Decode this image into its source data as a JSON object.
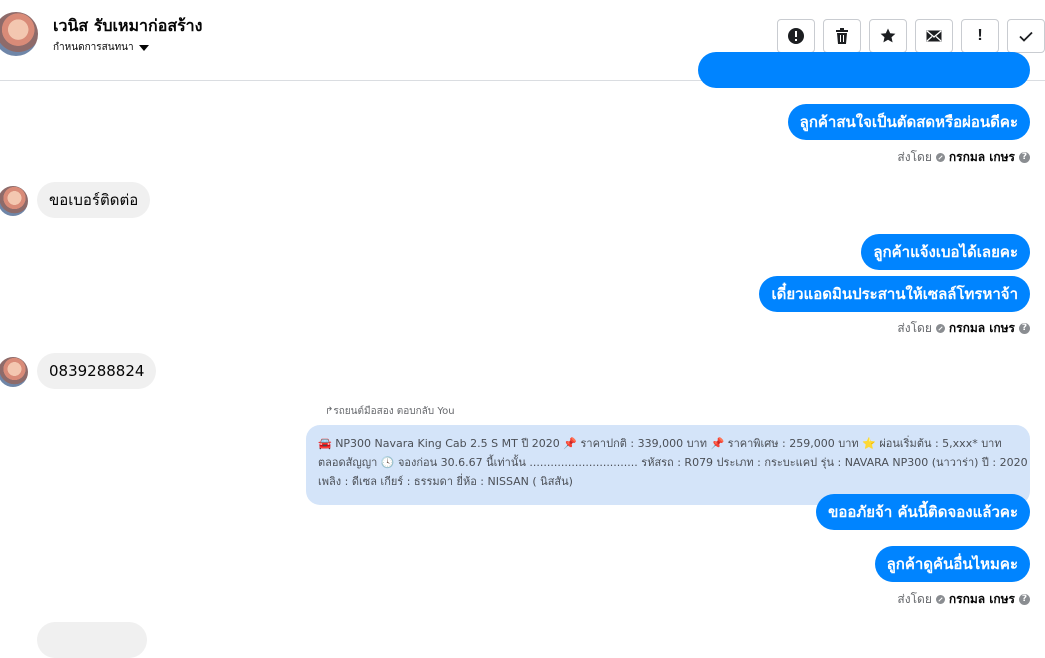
{
  "header": {
    "name": "เวนิส รับเหมาก่อสร้าง",
    "subtitle": "กำหนดการสนทนา",
    "toolbar": [
      "alert-circle-icon",
      "trash-icon",
      "star-icon",
      "mail-icon",
      "exclamation-icon",
      "check-icon"
    ]
  },
  "messages": {
    "out1": "ลูกค้าสนใจเป็นตัดสดหรือผ่อนดีคะ",
    "in1": "ขอเบอร์ติดต่อ",
    "out2": "ลูกค้าแจ้งเบอได้เลยคะ",
    "out3": "เดี๋ยวแอดมินประสานให้เซลล์โทรหาจ้า",
    "in2": "0839288824",
    "reply_label": "↱รถยนต์มือสอง ตอบกลับ You",
    "quote_line1": "🚘 NP300 Navara King Cab 2.5 S MT ปี 2020 📌 ราคาปกติ : 339,000 บาท 📌 ราคาพิเศษ : 259,000 บาท ⭐ ผ่อนเริ่มต้น : 5,xxx* บาท",
    "quote_line2": "ตลอดสัญญา 🕓 จองก่อน 30.6.67 นี้เท่านั้น ............................... รหัสรถ : R079 ประเภท : กระบะแคป รุ่น : NAVARA NP300 (นาวาร่า) ปี : 2020 เชื้อ",
    "quote_line3": "เพลิง : ดีเซล เกียร์ : ธรรมดา ยี่ห้อ : NISSAN ( นิสสัน)",
    "out4": "ขออภัยจ้า คันนี้ติดจองแล้วคะ",
    "out5": "ลูกค้าดูคันอื่นไหมคะ"
  },
  "sentby": {
    "label": "ส่งโดย",
    "who": "กรกมล เกษร"
  }
}
